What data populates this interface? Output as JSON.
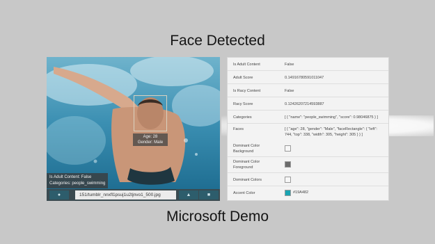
{
  "title": "Face Detected",
  "footer_caption": "Microsoft Demo",
  "photo": {
    "face_tag": {
      "age": "Age: 28",
      "gender": "Gender: Male"
    },
    "adult_tag": {
      "line1": "Is Adult Content: False",
      "line2": "Categories: people_swimming"
    },
    "toolbar": {
      "url": "151/tumblr_nnxfl1psuj1u2tjnvo1_500.jpg",
      "left_icon": "info-icon",
      "right_icons": [
        "cloud-upload-icon",
        "image-icon"
      ]
    }
  },
  "results": [
    {
      "key": "Is Adult Content",
      "value": "False"
    },
    {
      "key": "Adult Score",
      "value": "0.14916780591011047"
    },
    {
      "key": "Is Racy Content",
      "value": "False"
    },
    {
      "key": "Racy Score",
      "value": "0.12426207214593887"
    },
    {
      "key": "Categories",
      "value": "[ { \"name\": \"people_swimming\", \"score\": 0.98046875 } ]"
    },
    {
      "key": "Faces",
      "value": "[ { \"age\": 28, \"gender\": \"Male\", \"faceRectangle\": { \"left\": 744, \"top\": 338, \"width\": 305, \"height\": 305 } } ]"
    },
    {
      "key": "Dominant Color Background",
      "swatch": "#f7f7f7"
    },
    {
      "key": "Dominant Color Foreground",
      "swatch": "#6b6b6b"
    },
    {
      "key": "Dominant Colors",
      "swatch": "#f7f7f7"
    },
    {
      "key": "Accent Color",
      "swatch": "#19A4B2",
      "value": "#19A482"
    }
  ],
  "colors": {
    "page_background": "#c8c8c8",
    "accent": "#19A4B2"
  }
}
